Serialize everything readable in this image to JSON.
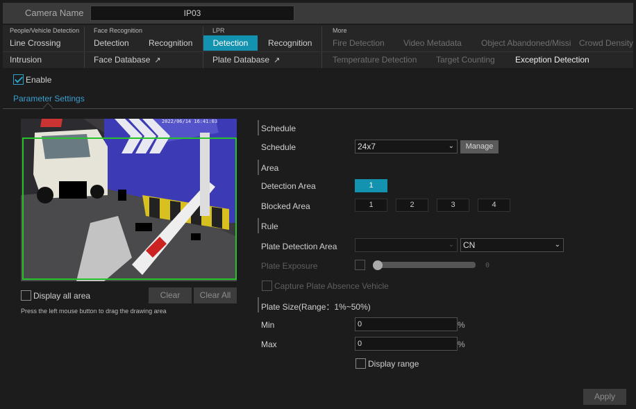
{
  "header": {
    "camera_label": "Camera Name",
    "camera_name": "IP03"
  },
  "tab_groups": {
    "people_vehicle": {
      "title": "People/Vehicle Detection",
      "tabs": [
        "Line Crossing",
        "Intrusion"
      ]
    },
    "face": {
      "title": "Face Recognition",
      "tabs": [
        "Detection",
        "Recognition",
        "Face Database"
      ]
    },
    "lpr": {
      "title": "LPR",
      "tabs": [
        "Detection",
        "Recognition",
        "Plate Database"
      ]
    },
    "more": {
      "title": "More",
      "tabs": [
        "Fire Detection",
        "Video Metadata",
        "Object Abandoned/Missi",
        "Crowd Density",
        "Temperature Detection",
        "Target Counting",
        "Exception Detection"
      ]
    }
  },
  "ext_glyph": "↗",
  "enable": {
    "label": "Enable",
    "checked": true
  },
  "param_tab": "Parameter Settings",
  "video": {
    "timestamp": "2022/06/14 16:41:03"
  },
  "draw": {
    "display_all_area": "Display all area",
    "clear": "Clear",
    "clear_all": "Clear All",
    "hint": "Press the left mouse button to drag the drawing area"
  },
  "schedule": {
    "section": "Schedule",
    "label": "Schedule",
    "value": "24x7",
    "manage": "Manage"
  },
  "area": {
    "section": "Area",
    "detection_label": "Detection Area",
    "detection_buttons": [
      "1"
    ],
    "blocked_label": "Blocked Area",
    "blocked_buttons": [
      "1",
      "2",
      "3",
      "4"
    ]
  },
  "rule": {
    "section": "Rule",
    "plate_detection_label": "Plate Detection Area",
    "plate_detection_value": "",
    "country": "CN",
    "exposure_label": "Plate Exposure",
    "exposure_value": "0",
    "capture_absence": "Capture Plate Absence Vehicle"
  },
  "plate_size": {
    "section": "Plate Size(Range：1%~50%)",
    "min_label": "Min",
    "min_value": "0",
    "max_label": "Max",
    "max_value": "0",
    "unit": "%",
    "display_range": "Display range"
  },
  "apply": "Apply",
  "colors": {
    "accent": "#1493b0",
    "roi": "#26c42a",
    "link": "#3a9fd0"
  }
}
